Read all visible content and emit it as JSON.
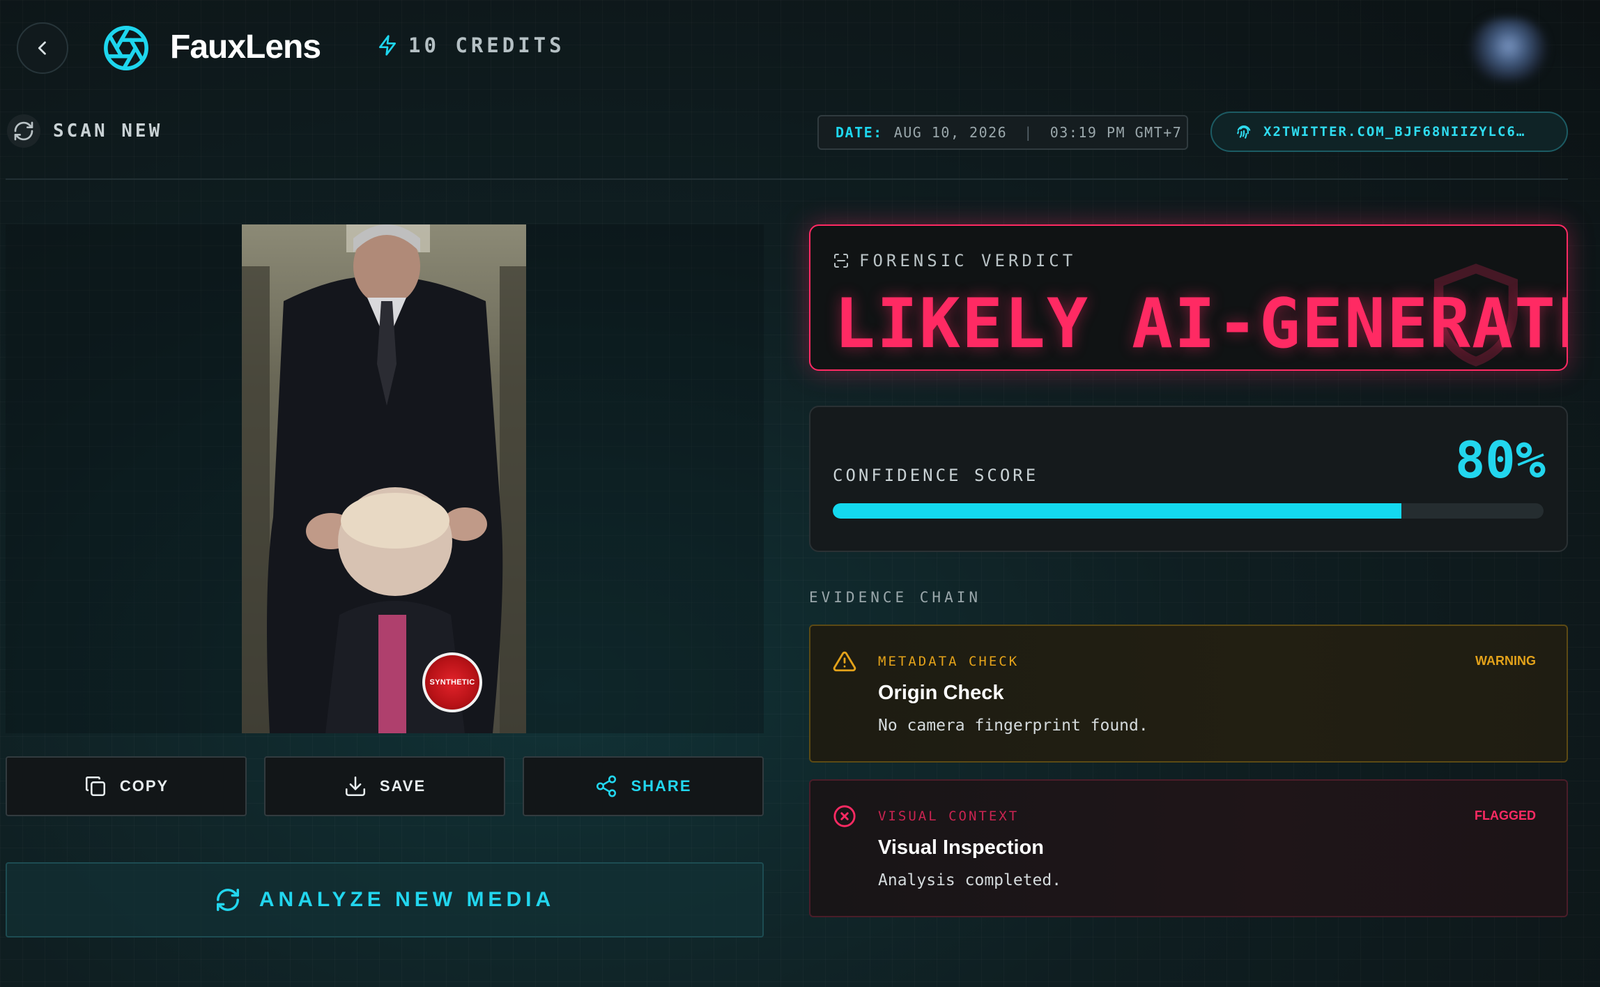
{
  "header": {
    "app_title": "FauxLens",
    "credits": "10 CREDITS"
  },
  "toolbar": {
    "scan_new": "SCAN NEW",
    "date_key": "DATE:",
    "date_value": "AUG 10, 2026",
    "date_separator": "|",
    "time_value": "03:19 PM GMT+7",
    "source": "X2TWITTER.COM_BJF68NIIZYLC6…"
  },
  "media": {
    "badge_text": "SYNTHETIC"
  },
  "actions": {
    "copy": "COPY",
    "save": "SAVE",
    "share": "SHARE",
    "analyze": "ANALYZE NEW MEDIA"
  },
  "verdict": {
    "label": "FORENSIC VERDICT",
    "result": "LIKELY AI-GENERATED"
  },
  "confidence": {
    "label": "CONFIDENCE SCORE",
    "value": "80%",
    "fraction": 0.8
  },
  "evidence": {
    "title": "EVIDENCE CHAIN",
    "items": [
      {
        "category": "METADATA CHECK",
        "status": "WARNING",
        "title": "Origin Check",
        "description": "No camera fingerprint found."
      },
      {
        "category": "VISUAL CONTEXT",
        "status": "FLAGGED",
        "title": "Visual Inspection",
        "description": "Analysis completed."
      }
    ]
  },
  "colors": {
    "accent_cyan": "#22d6ee",
    "verdict_red": "#ff2a63",
    "warning_amber": "#e3a21a"
  },
  "icons": [
    "chevron-left-icon",
    "aperture-icon",
    "bolt-icon",
    "refresh-icon",
    "fingerprint-icon",
    "copy-icon",
    "download-icon",
    "share-icon",
    "scan-icon",
    "shield-icon",
    "warning-icon",
    "error-icon"
  ]
}
